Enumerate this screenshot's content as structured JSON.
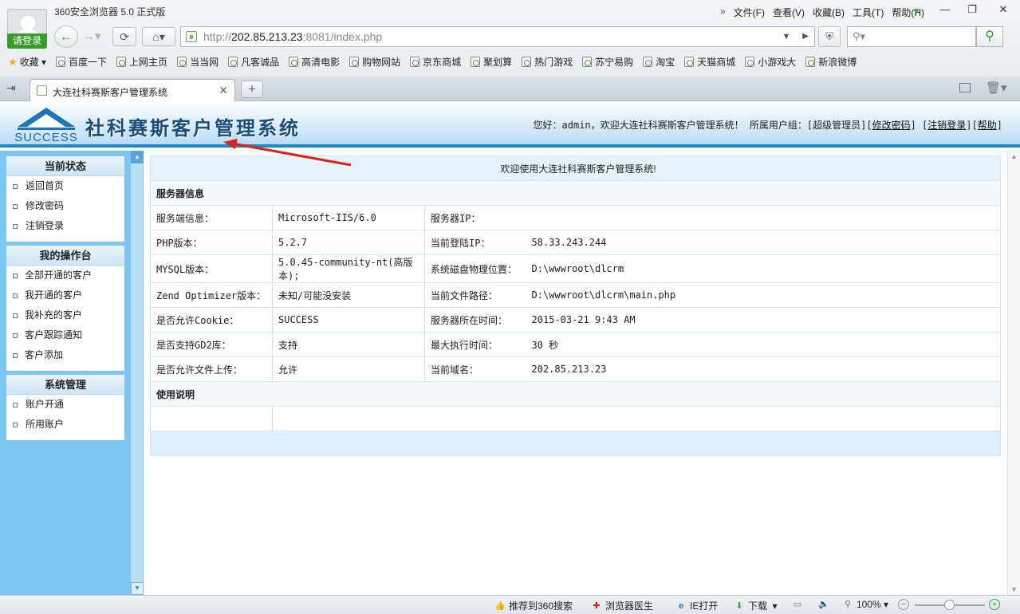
{
  "browser": {
    "app_title": "360安全浏览器 5.0 正式版",
    "login_label": "请登录",
    "menu": [
      "文件(F)",
      "查看(V)",
      "收藏(B)",
      "工具(T)",
      "帮助(H)"
    ],
    "menu_more": "»",
    "url_scheme": "http://",
    "url_host": "202.85.213.23",
    "url_rest": ":8081/index.php",
    "favorites_label": "收藏",
    "bookmarks": [
      "百度一下",
      "上网主页",
      "当当网",
      "凡客诚品",
      "高清电影",
      "购物网站",
      "京东商城",
      "聚划算",
      "热门游戏",
      "苏宁易购",
      "淘宝",
      "天猫商城",
      "小游戏大",
      "新浪微博"
    ],
    "tab_title": "大连社科赛斯客户管理系统",
    "statusbar": {
      "recommend": "推荐到360搜索",
      "doctor": "浏览器医生",
      "ie_open": "IE打开",
      "download": "下载",
      "zoom": "100%"
    }
  },
  "site": {
    "logo_text": "SUCCESS",
    "system_title": "社科赛斯客户管理系统",
    "greeting": "您好：admin，欢迎大连社科赛斯客户管理系统！ 所属用户组：[超级管理员]",
    "link_change_password": "修改密码",
    "link_logout": "注销登录",
    "link_help": "帮助"
  },
  "leftnav": {
    "sections": [
      {
        "title": "当前状态",
        "items": [
          "返回首页",
          "修改密码",
          "注销登录"
        ]
      },
      {
        "title": "我的操作台",
        "items": [
          "全部开通的客户",
          "我开通的客户",
          "我补充的客户",
          "客户跟踪通知",
          "客户添加"
        ]
      },
      {
        "title": "系统管理",
        "items": [
          "账户开通",
          "所用账户"
        ]
      }
    ]
  },
  "main": {
    "welcome": "欢迎使用大连社科赛斯客户管理系统!",
    "server_section": "服务器信息",
    "usage_section": "使用说明",
    "rows": [
      [
        "服务端信息：",
        "Microsoft-IIS/6.0",
        "服务器IP：",
        ""
      ],
      [
        "PHP版本：",
        "5.2.7",
        "当前登陆IP：",
        "58.33.243.244"
      ],
      [
        "MYSQL版本：",
        "5.0.45-community-nt(高版本);",
        "系统磁盘物理位置：",
        "D:\\wwwroot\\dlcrm"
      ],
      [
        "Zend Optimizer版本：",
        "未知/可能没安装",
        "当前文件路径：",
        "D:\\wwwroot\\dlcrm\\main.php"
      ],
      [
        "是否允许Cookie：",
        "SUCCESS",
        "服务器所在时间：",
        "2015-03-21 9:43 AM"
      ],
      [
        "是否支持GD2库：",
        "支持",
        "最大执行时间：",
        "30 秒"
      ],
      [
        "是否允许文件上传：",
        "允许",
        "当前域名：",
        "202.85.213.23"
      ]
    ]
  },
  "colors": {
    "nav_bg": "#7cc6f0",
    "header_line": "#1a88d0",
    "arrow": "#e0201c"
  }
}
